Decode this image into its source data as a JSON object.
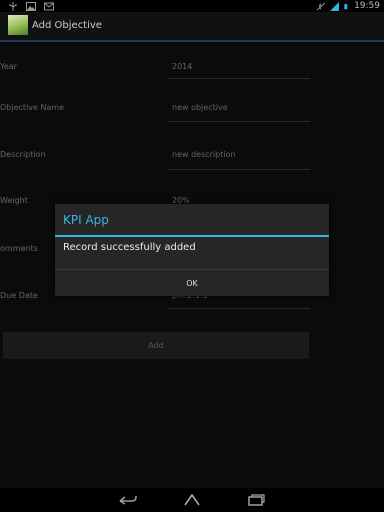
{
  "status_bar": {
    "time": "19:59",
    "icons": [
      "usb-icon",
      "image-icon",
      "mail-icon",
      "mute-icon",
      "signal-icon",
      "battery-icon"
    ]
  },
  "action_bar": {
    "title": "Add Objective",
    "icon": "app-icon"
  },
  "form": {
    "rows": [
      {
        "label": "Year",
        "value": "2014"
      },
      {
        "label": "Objective Name",
        "value": "new objective"
      },
      {
        "label": "Description",
        "value": "new description"
      },
      {
        "label": "Weight",
        "value": "20%"
      },
      {
        "label": "omments",
        "value": ""
      },
      {
        "label": "Due Date",
        "value": "pm.2.1.5"
      }
    ],
    "add_label": "Add"
  },
  "dialog": {
    "title": "KPI App",
    "message": "Record successfully added",
    "ok_label": "OK"
  },
  "nav_bar": {
    "icons": [
      "back-icon",
      "home-icon",
      "recents-icon"
    ]
  },
  "colors": {
    "accent": "#33b5e5",
    "background": "#000000",
    "dialog": "#262626"
  }
}
